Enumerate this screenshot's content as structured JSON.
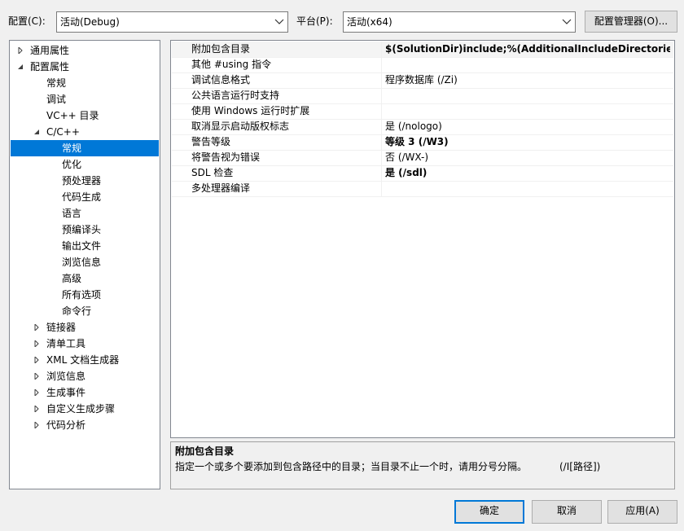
{
  "toolbar": {
    "config_label": "配置(C):",
    "config_value": "活动(Debug)",
    "platform_label": "平台(P):",
    "platform_value": "活动(x64)",
    "config_manager_button": "配置管理器(O)..."
  },
  "tree": [
    {
      "label": "通用属性",
      "level": 0,
      "expander": "collapsed"
    },
    {
      "label": "配置属性",
      "level": 0,
      "expander": "expanded"
    },
    {
      "label": "常规",
      "level": 1,
      "expander": "none"
    },
    {
      "label": "调试",
      "level": 1,
      "expander": "none"
    },
    {
      "label": "VC++ 目录",
      "level": 1,
      "expander": "none"
    },
    {
      "label": "C/C++",
      "level": 1,
      "expander": "expanded"
    },
    {
      "label": "常规",
      "level": 2,
      "expander": "none",
      "selected": true
    },
    {
      "label": "优化",
      "level": 2,
      "expander": "none"
    },
    {
      "label": "预处理器",
      "level": 2,
      "expander": "none"
    },
    {
      "label": "代码生成",
      "level": 2,
      "expander": "none"
    },
    {
      "label": "语言",
      "level": 2,
      "expander": "none"
    },
    {
      "label": "预编译头",
      "level": 2,
      "expander": "none"
    },
    {
      "label": "输出文件",
      "level": 2,
      "expander": "none"
    },
    {
      "label": "浏览信息",
      "level": 2,
      "expander": "none"
    },
    {
      "label": "高级",
      "level": 2,
      "expander": "none"
    },
    {
      "label": "所有选项",
      "level": 2,
      "expander": "none"
    },
    {
      "label": "命令行",
      "level": 2,
      "expander": "none"
    },
    {
      "label": "链接器",
      "level": 1,
      "expander": "collapsed"
    },
    {
      "label": "清单工具",
      "level": 1,
      "expander": "collapsed"
    },
    {
      "label": "XML 文档生成器",
      "level": 1,
      "expander": "collapsed"
    },
    {
      "label": "浏览信息",
      "level": 1,
      "expander": "collapsed"
    },
    {
      "label": "生成事件",
      "level": 1,
      "expander": "collapsed"
    },
    {
      "label": "自定义生成步骤",
      "level": 1,
      "expander": "collapsed"
    },
    {
      "label": "代码分析",
      "level": 1,
      "expander": "collapsed"
    }
  ],
  "properties": [
    {
      "name": "附加包含目录",
      "value": "$(SolutionDir)include;%(AdditionalIncludeDirectories)",
      "bold": true,
      "selected": true
    },
    {
      "name": "其他 #using 指令",
      "value": "",
      "bold": false
    },
    {
      "name": "调试信息格式",
      "value": "程序数据库 (/Zi)",
      "bold": false
    },
    {
      "name": "公共语言运行时支持",
      "value": "",
      "bold": false
    },
    {
      "name": "使用 Windows 运行时扩展",
      "value": "",
      "bold": false
    },
    {
      "name": "取消显示启动版权标志",
      "value": "是 (/nologo)",
      "bold": false
    },
    {
      "name": "警告等级",
      "value": "等级 3 (/W3)",
      "bold": true
    },
    {
      "name": "将警告视为错误",
      "value": "否 (/WX-)",
      "bold": false
    },
    {
      "name": "SDL 检查",
      "value": "是 (/sdl)",
      "bold": true
    },
    {
      "name": "多处理器编译",
      "value": "",
      "bold": false
    }
  ],
  "description": {
    "title": "附加包含目录",
    "text": "指定一个或多个要添加到包含路径中的目录；当目录不止一个时，请用分号分隔。",
    "switch": "(/I[路径])"
  },
  "buttons": {
    "ok": "确定",
    "cancel": "取消",
    "apply": "应用(A)"
  },
  "colors": {
    "selection": "#0078d7",
    "window_bg": "#f0f0f0"
  }
}
